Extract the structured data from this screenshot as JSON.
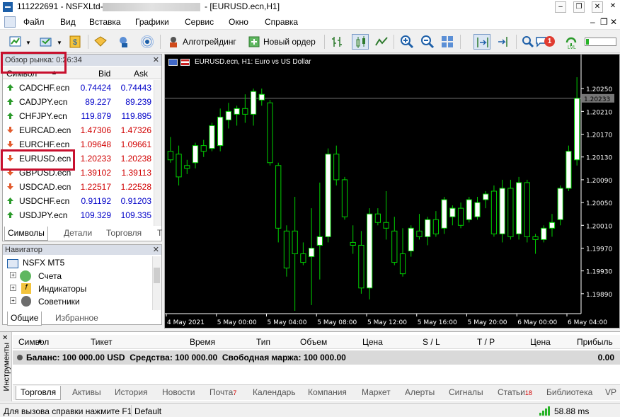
{
  "window": {
    "title_left": "111222691 - NSFXLtd-",
    "title_right": "- [EURUSD.ecn,H1]"
  },
  "menu": [
    "Файл",
    "Вид",
    "Вставка",
    "Графики",
    "Сервис",
    "Окно",
    "Справка"
  ],
  "toolbar": {
    "algotrading_label": "Алготрейдинг",
    "new_order_label": "Новый ордер",
    "notification_count": "1",
    "signal_label": "LVL"
  },
  "market_watch": {
    "title": "Обзор рынка: 0",
    "time": ":26:34",
    "col_symbol": "Символ",
    "col_bid": "Bid",
    "col_ask": "Ask",
    "rows": [
      {
        "symbol": "CADCHF.ecn",
        "bid": "0.74424",
        "ask": "0.74443",
        "dir": "up"
      },
      {
        "symbol": "CADJPY.ecn",
        "bid": "89.227",
        "ask": "89.239",
        "dir": "up"
      },
      {
        "symbol": "CHFJPY.ecn",
        "bid": "119.879",
        "ask": "119.895",
        "dir": "up"
      },
      {
        "symbol": "EURCAD.ecn",
        "bid": "1.47306",
        "ask": "1.47326",
        "dir": "down"
      },
      {
        "symbol": "EURCHF.ecn",
        "bid": "1.09648",
        "ask": "1.09661",
        "dir": "down"
      },
      {
        "symbol": "EURUSD.ecn",
        "bid": "1.20233",
        "ask": "1.20238",
        "dir": "down"
      },
      {
        "symbol": "GBPUSD.ecn",
        "bid": "1.39102",
        "ask": "1.39113",
        "dir": "down"
      },
      {
        "symbol": "USDCAD.ecn",
        "bid": "1.22517",
        "ask": "1.22528",
        "dir": "down"
      },
      {
        "symbol": "USDCHF.ecn",
        "bid": "0.91192",
        "ask": "0.91203",
        "dir": "up"
      },
      {
        "symbol": "USDJPY.ecn",
        "bid": "109.329",
        "ask": "109.335",
        "dir": "up"
      }
    ],
    "tabs": [
      "Символы",
      "Детали",
      "Торговля",
      "Т"
    ]
  },
  "navigator": {
    "title": "Навигатор",
    "root": "NSFX MT5",
    "items": [
      "Счета",
      "Индикаторы",
      "Советники"
    ],
    "tabs": [
      "Общие",
      "Избранное"
    ]
  },
  "chart": {
    "label": "EURUSD.ecn, H1:  Euro vs US Dollar",
    "current_price": "1.20233",
    "price_ticks": [
      "1.20250",
      "1.20210",
      "1.20170",
      "1.20130",
      "1.20090",
      "1.20050",
      "1.20010",
      "1.19970",
      "1.19930",
      "1.19890"
    ],
    "time_ticks": [
      "4 May 2021",
      "5 May 00:00",
      "5 May 04:00",
      "5 May 08:00",
      "5 May 12:00",
      "5 May 16:00",
      "5 May 20:00",
      "6 May 00:00",
      "6 May 04:00"
    ]
  },
  "chart_data": {
    "type": "candlestick",
    "ylim": [
      1.19855,
      1.20285
    ],
    "candles": [
      {
        "o": 1.2014,
        "h": 1.20165,
        "l": 1.2012,
        "c": 1.20125
      },
      {
        "o": 1.20135,
        "h": 1.2015,
        "l": 1.2008,
        "c": 1.20095
      },
      {
        "o": 1.20115,
        "h": 1.20125,
        "l": 1.201,
        "c": 1.2011
      },
      {
        "o": 1.2012,
        "h": 1.20155,
        "l": 1.2011,
        "c": 1.2015
      },
      {
        "o": 1.2015,
        "h": 1.2016,
        "l": 1.2013,
        "c": 1.2014
      },
      {
        "o": 1.20145,
        "h": 1.2019,
        "l": 1.2014,
        "c": 1.20185
      },
      {
        "o": 1.2015,
        "h": 1.20215,
        "l": 1.2014,
        "c": 1.202
      },
      {
        "o": 1.20195,
        "h": 1.20225,
        "l": 1.2018,
        "c": 1.2021
      },
      {
        "o": 1.20205,
        "h": 1.2022,
        "l": 1.20185,
        "c": 1.20215
      },
      {
        "o": 1.20215,
        "h": 1.2024,
        "l": 1.2019,
        "c": 1.20205
      },
      {
        "o": 1.20205,
        "h": 1.2025,
        "l": 1.20185,
        "c": 1.20245
      },
      {
        "o": 1.2023,
        "h": 1.2025,
        "l": 1.2022,
        "c": 1.2024
      },
      {
        "o": 1.20225,
        "h": 1.2023,
        "l": 1.20115,
        "c": 1.2012
      },
      {
        "o": 1.20115,
        "h": 1.2012,
        "l": 1.1998,
        "c": 1.20005
      },
      {
        "o": 1.2,
        "h": 1.2001,
        "l": 1.1992,
        "c": 1.19935
      },
      {
        "o": 1.2,
        "h": 1.2006,
        "l": 1.1986,
        "c": 1.1996
      },
      {
        "o": 1.1996,
        "h": 1.1998,
        "l": 1.1994,
        "c": 1.19945
      },
      {
        "o": 1.19955,
        "h": 1.2004,
        "l": 1.1987,
        "c": 1.1997
      },
      {
        "o": 1.19975,
        "h": 1.20085,
        "l": 1.19915,
        "c": 1.1999
      },
      {
        "o": 1.1999,
        "h": 1.20145,
        "l": 1.1998,
        "c": 1.20135
      },
      {
        "o": 1.20135,
        "h": 1.2015,
        "l": 1.2008,
        "c": 1.2009
      },
      {
        "o": 1.2009,
        "h": 1.20095,
        "l": 1.2002,
        "c": 1.20025
      },
      {
        "o": 1.1998,
        "h": 1.2001,
        "l": 1.1996,
        "c": 1.19975
      },
      {
        "o": 1.19975,
        "h": 1.2,
        "l": 1.1989,
        "c": 1.199
      },
      {
        "o": 1.199,
        "h": 1.2004,
        "l": 1.1988,
        "c": 1.2003
      },
      {
        "o": 1.2003,
        "h": 1.2004,
        "l": 1.2001,
        "c": 1.20015
      },
      {
        "o": 1.20015,
        "h": 1.2007,
        "l": 1.19985,
        "c": 1.20005
      },
      {
        "o": 1.2,
        "h": 1.20025,
        "l": 1.1994,
        "c": 1.19945
      },
      {
        "o": 1.1996,
        "h": 1.20005,
        "l": 1.1992,
        "c": 1.19925
      },
      {
        "o": 1.19965,
        "h": 1.2001,
        "l": 1.19955,
        "c": 1.20005
      },
      {
        "o": 1.2,
        "h": 1.2003,
        "l": 1.19985,
        "c": 1.1999
      },
      {
        "o": 1.1999,
        "h": 1.20025,
        "l": 1.19975,
        "c": 1.2002
      },
      {
        "o": 1.2002,
        "h": 1.20035,
        "l": 1.1999,
        "c": 1.19995
      },
      {
        "o": 1.20005,
        "h": 1.2006,
        "l": 1.19995,
        "c": 1.20055
      },
      {
        "o": 1.20025,
        "h": 1.20045,
        "l": 1.2001,
        "c": 1.2004
      },
      {
        "o": 1.2004,
        "h": 1.2005,
        "l": 1.20005,
        "c": 1.2001
      },
      {
        "o": 1.2002,
        "h": 1.2006,
        "l": 1.20015,
        "c": 1.20055
      },
      {
        "o": 1.20025,
        "h": 1.2006,
        "l": 1.2002,
        "c": 1.2005
      },
      {
        "o": 1.20055,
        "h": 1.2007,
        "l": 1.2004,
        "c": 1.20065
      },
      {
        "o": 1.2007,
        "h": 1.2008,
        "l": 1.1999,
        "c": 1.19995
      },
      {
        "o": 1.19995,
        "h": 1.2009,
        "l": 1.1998,
        "c": 1.20075
      },
      {
        "o": 1.20075,
        "h": 1.2009,
        "l": 1.19985,
        "c": 1.1999
      },
      {
        "o": 1.19995,
        "h": 1.20095,
        "l": 1.19985,
        "c": 1.20085
      },
      {
        "o": 1.20085,
        "h": 1.2009,
        "l": 1.1998,
        "c": 1.1999
      },
      {
        "o": 1.1999,
        "h": 1.19995,
        "l": 1.1996,
        "c": 1.19985
      },
      {
        "o": 1.19985,
        "h": 1.2001,
        "l": 1.1998,
        "c": 1.20005
      },
      {
        "o": 1.20005,
        "h": 1.2003,
        "l": 1.1999,
        "c": 1.20015
      },
      {
        "o": 1.2002,
        "h": 1.2008,
        "l": 1.2001,
        "c": 1.20075
      },
      {
        "o": 1.20075,
        "h": 1.2015,
        "l": 1.2007,
        "c": 1.2014
      },
      {
        "o": 1.20125,
        "h": 1.2027,
        "l": 1.20115,
        "c": 1.20233
      }
    ]
  },
  "toolbox": {
    "side_label": "Инструменты",
    "columns": [
      "Символ",
      "Тикет",
      "Время",
      "Тип",
      "Объем",
      "Цена",
      "S / L",
      "T / P",
      "Цена",
      "Прибыль"
    ],
    "balance_label": "Баланс: 100 000.00 USD  Средства: 100 000.00  Свободная маржа: 100 000.00",
    "balance_profit": "0.00",
    "tabs": [
      {
        "label": "Торговля",
        "badge": ""
      },
      {
        "label": "Активы",
        "badge": ""
      },
      {
        "label": "История",
        "badge": ""
      },
      {
        "label": "Новости",
        "badge": ""
      },
      {
        "label": "Почта",
        "badge": "7"
      },
      {
        "label": "Календарь",
        "badge": ""
      },
      {
        "label": "Компания",
        "badge": ""
      },
      {
        "label": "Маркет",
        "badge": ""
      },
      {
        "label": "Алерты",
        "badge": ""
      },
      {
        "label": "Сигналы",
        "badge": ""
      },
      {
        "label": "Статьи",
        "badge": "18"
      },
      {
        "label": "Библиотека",
        "badge": ""
      },
      {
        "label": "VP",
        "badge": ""
      }
    ]
  },
  "status": {
    "help": "Для вызова справки нажмите F1",
    "profile": "Default",
    "ping": "58.88 ms"
  },
  "colors": {
    "chart_bg": "#000000",
    "candle_wick": "#00d000",
    "bull_body": "#ffffff",
    "bear_body": "#000000",
    "highlight": "#c8102e",
    "axis_text": "#ffffff"
  }
}
